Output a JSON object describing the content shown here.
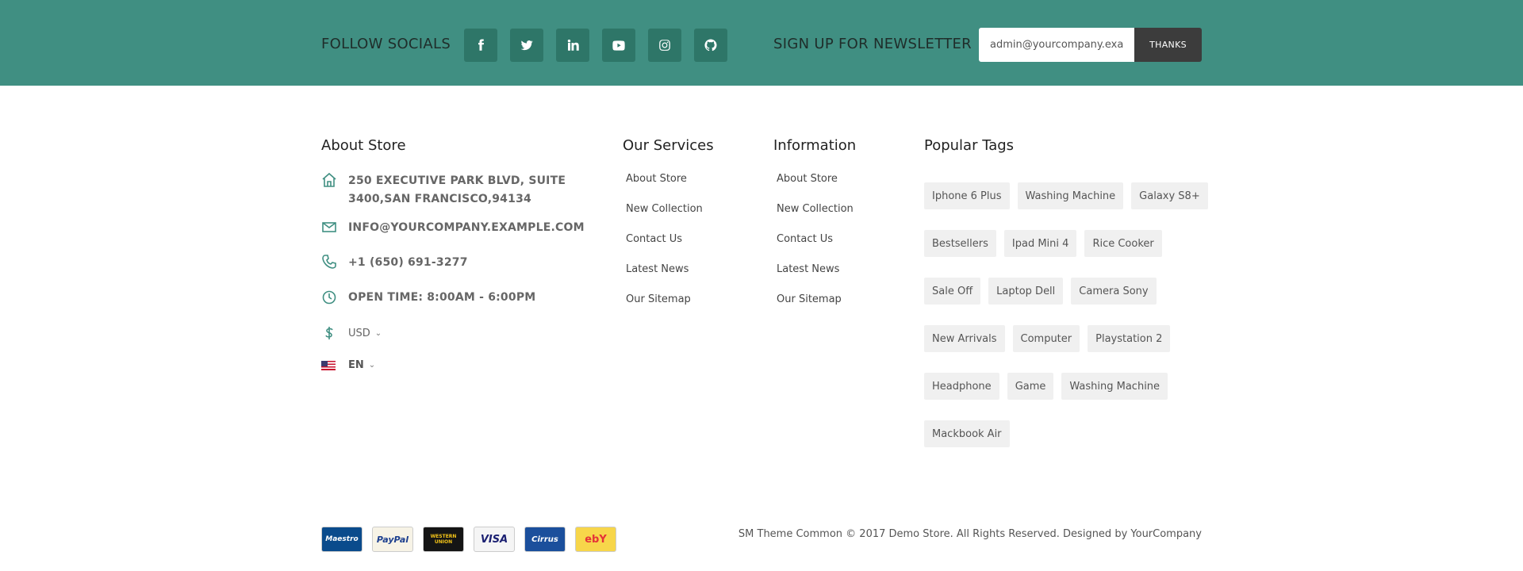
{
  "top": {
    "follow_title": "FOLLOW SOCIALS",
    "socials": [
      "facebook-icon",
      "twitter-icon",
      "linkedin-icon",
      "youtube-icon",
      "instagram-icon",
      "github-icon"
    ],
    "newsletter_title": "SIGN UP FOR NEWSLETTER",
    "newsletter_value": "admin@yourcompany.examp",
    "newsletter_button": "THANKS"
  },
  "about": {
    "title": "About Store",
    "address": "250 Executive Park Blvd, Suite 3400,San Francisco,94134",
    "email": "info@yourcompany.example.com",
    "phone": "+1 (650) 691-3277",
    "open_time": "Open time: 8:00AM - 6:00PM",
    "currency": "USD",
    "language": "EN"
  },
  "services": {
    "title": "Our Services",
    "links": [
      "About Store",
      "New Collection",
      "Contact Us",
      "Latest News",
      "Our Sitemap"
    ]
  },
  "information": {
    "title": "Information",
    "links": [
      "About Store",
      "New Collection",
      "Contact Us",
      "Latest News",
      "Our Sitemap"
    ]
  },
  "tags": {
    "title": "Popular Tags",
    "rows": [
      [
        "Iphone 6 Plus",
        "Washing Machine",
        "Galaxy S8+"
      ],
      [
        "Bestsellers",
        "Ipad Mini 4",
        "Rice Cooker"
      ],
      [
        "Sale Off",
        "Laptop Dell",
        "Camera Sony"
      ],
      [
        "New Arrivals",
        "Computer",
        "Playstation 2"
      ],
      [
        "Headphone",
        "Game",
        "Washing Machine"
      ],
      [
        "Mackbook Air"
      ]
    ]
  },
  "payments": [
    "Maestro",
    "PayPal",
    "WESTERN UNION",
    "VISA",
    "Cirrus",
    "ebY"
  ],
  "copyright": "SM Theme Common © 2017 Demo Store. All Rights Reserved. Designed by YourCompany",
  "colors": {
    "accent": "#408f82",
    "social_bg": "#2e7668",
    "button_dark": "#3c3c3c"
  }
}
